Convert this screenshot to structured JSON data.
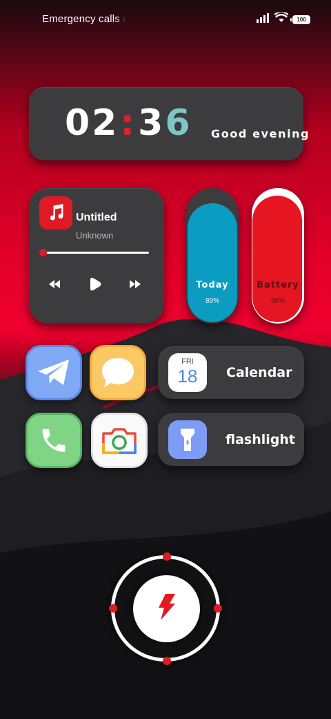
{
  "status_bar": {
    "carrier_text": "Emergency calls only",
    "battery_level": "100",
    "icons": [
      "signal-icon",
      "wifi-icon",
      "battery-icon"
    ]
  },
  "clock": {
    "hour": "02",
    "separator": ":",
    "minute_first": "3",
    "minute_last": "6",
    "greeting": "Good evening"
  },
  "music": {
    "title": "Untitled",
    "artist": "Unknown",
    "progress": 0,
    "controls": [
      "previous-icon",
      "play-icon",
      "next-icon"
    ]
  },
  "pills": {
    "today": {
      "label": "Today",
      "value": "89%"
    },
    "battery": {
      "label": "Battery",
      "value": "96%"
    }
  },
  "apps": [
    {
      "name": "telegram-icon"
    },
    {
      "name": "messages-icon"
    },
    {
      "name": "phone-icon"
    },
    {
      "name": "camera-icon"
    }
  ],
  "calendar": {
    "day": "FRI",
    "date": "18",
    "label": "Calendar"
  },
  "flashlight": {
    "label": "flashlight"
  },
  "colors": {
    "accent_red": "#e01a24",
    "today_blue": "#0b9cc2",
    "battery_red": "#e51522",
    "card_gray": "#3c3c3f",
    "clock_teal": "#7fc6c4"
  }
}
